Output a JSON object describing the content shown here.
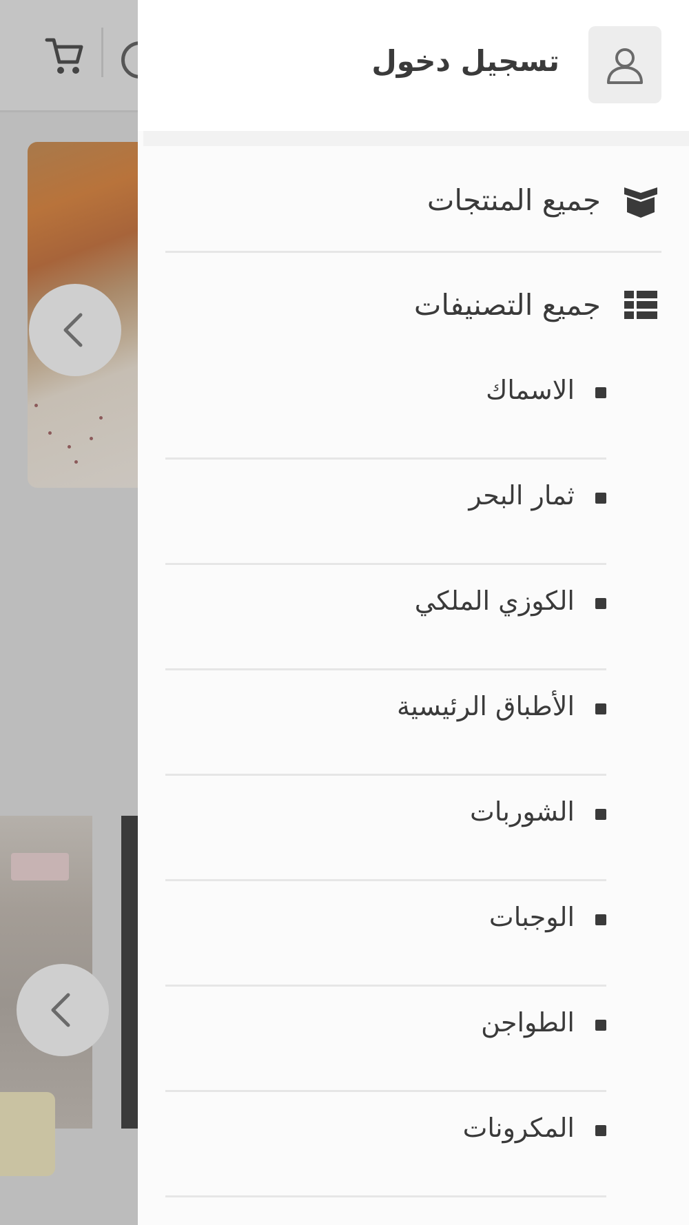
{
  "drawer": {
    "login_label": "تسجيل دخول",
    "nav": {
      "all_products": "جميع المنتجات",
      "all_categories": "جميع التصنيفات"
    },
    "categories": [
      {
        "label": "الاسماك"
      },
      {
        "label": "ثمار البحر"
      },
      {
        "label": "الكوزي الملكي"
      },
      {
        "label": "الأطباق الرئيسية"
      },
      {
        "label": "الشوربات"
      },
      {
        "label": "الوجبات"
      },
      {
        "label": "الطواجن"
      },
      {
        "label": "المكرونات"
      }
    ]
  },
  "icons": {
    "user": "user-icon",
    "products": "box-open-icon",
    "categories": "list-icon",
    "cart": "cart-icon",
    "prev": "chevron-left-icon"
  },
  "colors": {
    "overlay": "#bcbcbc",
    "drawer_bg": "#fbfbfb",
    "text": "#3a3a3a",
    "divider": "#e6e6e6"
  }
}
